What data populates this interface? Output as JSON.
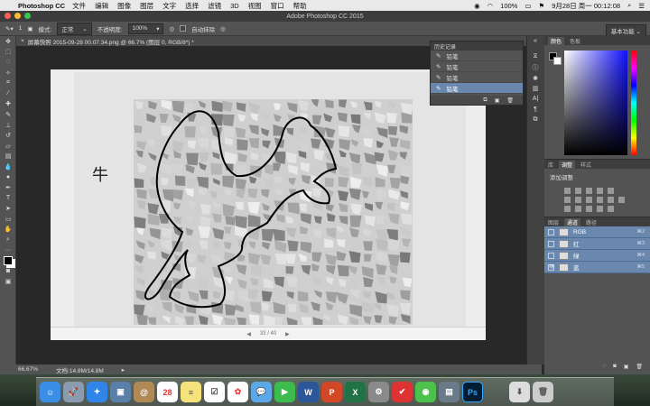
{
  "menubar": {
    "app": "Photoshop CC",
    "items": [
      "文件",
      "编辑",
      "图像",
      "图层",
      "文字",
      "选择",
      "滤镜",
      "3D",
      "视图",
      "窗口",
      "帮助"
    ],
    "battery": "100%",
    "clock": "9月28日 周一 00:12:08"
  },
  "window": {
    "title": "Adobe Photoshop CC 2015"
  },
  "options": {
    "mode_label": "模式:",
    "mode_value": "正常",
    "opacity_label": "不透明度:",
    "opacity_value": "100%",
    "auto_erase": "自动抹除",
    "brush_size": "1",
    "workspace": "基本功能"
  },
  "document": {
    "tab": "屏幕快照 2015-09-28 00.07.34.png @ 66.7% (图层 0, RGB/8*) *",
    "glyph": "牛",
    "page_indicator": "33 / 40"
  },
  "status": {
    "zoom": "66.67%",
    "doc_size": "文档:14.8M/14.8M"
  },
  "history": {
    "title": "历史记录",
    "items": [
      "铅笔",
      "铅笔",
      "铅笔",
      "铅笔"
    ]
  },
  "right_panel": {
    "color_tabs": [
      "颜色",
      "色板"
    ],
    "adjust_tabs": [
      "库",
      "调整",
      "样式"
    ],
    "adjust_title": "添加调整",
    "channel_tabs": [
      "图层",
      "通道",
      "路径"
    ],
    "channels": [
      {
        "name": "RGB",
        "key": "⌘2"
      },
      {
        "name": "红",
        "key": "⌘3"
      },
      {
        "name": "绿",
        "key": "⌘4"
      },
      {
        "name": "蓝",
        "key": "⌘5"
      }
    ]
  },
  "colors": {
    "accent": "#6a88ad",
    "panel": "#535353",
    "canvas": "#282828"
  }
}
